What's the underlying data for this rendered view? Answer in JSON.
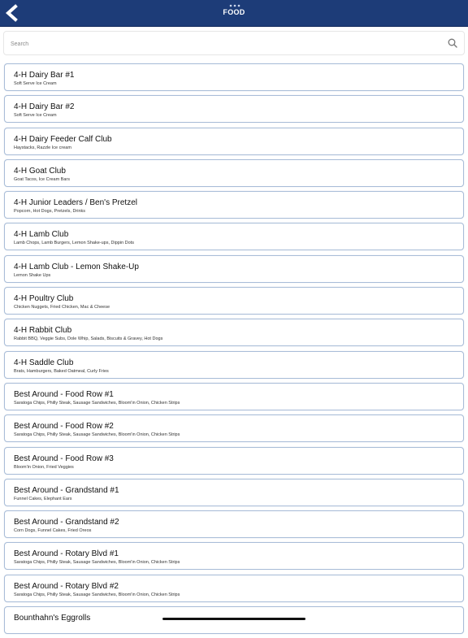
{
  "header": {
    "title": "FOOD",
    "back_icon": "chevron-left-icon",
    "accent_color": "#1d3c78"
  },
  "search": {
    "placeholder": "Search",
    "value": "",
    "icon": "search-icon"
  },
  "items": [
    {
      "title": "4-H Dairy Bar #1",
      "subtitle": "Soft Serve Ice Cream"
    },
    {
      "title": "4-H Dairy Bar #2",
      "subtitle": "Soft Serve Ice Cream"
    },
    {
      "title": "4-H Dairy Feeder Calf Club",
      "subtitle": "Haystacks, Razzle Ice cream"
    },
    {
      "title": "4-H Goat Club",
      "subtitle": "Goat Tacos, Ice Cream Bars"
    },
    {
      "title": "4-H Junior Leaders / Ben's Pretzel",
      "subtitle": "Popcorn, Hot Dogs, Pretzels, Drinks"
    },
    {
      "title": "4-H Lamb Club",
      "subtitle": "Lamb Chops, Lamb Burgers, Lemon Shake-ups, Dippin Dots"
    },
    {
      "title": "4-H Lamb Club - Lemon Shake-Up",
      "subtitle": "Lemon Shake Ups"
    },
    {
      "title": "4-H Poultry Club",
      "subtitle": "Chicken Nuggets, Fried Chicken, Mac & Cheese"
    },
    {
      "title": "4-H Rabbit Club",
      "subtitle": "Rabbit BBQ, Veggie Subs, Dole Whip, Salads, Biscuits & Gravey, Hot Dogs"
    },
    {
      "title": "4-H Saddle Club",
      "subtitle": "Brats, Hamburgers, Baked Oatmeal, Curly Fries"
    },
    {
      "title": "Best Around - Food Row #1",
      "subtitle": "Saratoga Chips, Philly Steak, Sausage Sandwiches, Bloom'in Onion, Chicken Strips"
    },
    {
      "title": "Best Around - Food Row #2",
      "subtitle": "Saratoga Chips, Philly Steak, Sausage Sandwiches, Bloom'in Onion, Chicken Strips"
    },
    {
      "title": "Best Around - Food Row #3",
      "subtitle": "Bloom'in Onion, Fried Veggies"
    },
    {
      "title": "Best Around - Grandstand #1",
      "subtitle": "Funnel Cakes, Elephant Ears"
    },
    {
      "title": "Best Around - Grandstand #2",
      "subtitle": "Corn Dogs, Funnel Cakes, Fried Oreos"
    },
    {
      "title": "Best Around - Rotary Blvd #1",
      "subtitle": "Saratoga Chips, Philly Steak, Sausage Sandwiches, Bloom'in Onion, Chicken Strips"
    },
    {
      "title": "Best Around - Rotary Blvd #2",
      "subtitle": "Saratoga Chips, Philly Steak, Sausage Sandwiches, Bloom'in Onion, Chicken Strips"
    },
    {
      "title": "Bounthahn's Eggrolls",
      "subtitle": ""
    }
  ]
}
